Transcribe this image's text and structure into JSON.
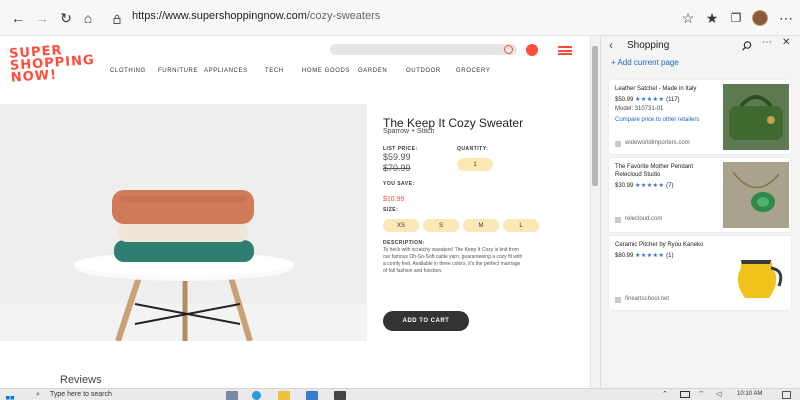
{
  "browser": {
    "url_host": "https://www.supershoppingnow.com",
    "url_path": "/cozy-sweaters"
  },
  "site": {
    "logo_lines": [
      "SUPER",
      "SHOPPING",
      "NOW!"
    ],
    "nav": [
      "CLOTHING",
      "FURNITURE",
      "APPLIANCES",
      "TECH",
      "HOME GOODS",
      "GARDEN",
      "OUTDOOR",
      "GROCERY"
    ]
  },
  "product": {
    "title": "The Keep It Cozy Sweater",
    "brand": "Sparrow + Stitch",
    "list_price_label": "LIST PRICE:",
    "list_price": "$59.99",
    "old_price": "$70.99",
    "quantity_label": "QUANTITY:",
    "quantity": "1",
    "you_save_label": "YOU SAVE:",
    "you_save": "$10.99",
    "size_label": "SIZE:",
    "sizes": [
      "XS",
      "S",
      "M",
      "L"
    ],
    "description_label": "DESCRIPTION:",
    "description": "To heck with scratchy sweaters! The Keep It Cozy is knit from our famous Oh-So-Soft cable yarn, guaranteeing a cozy fit with a comfy feel. Available in three colors, it's the perfect marriage of fall fashion and function.",
    "add_to_cart": "ADD TO CART",
    "reviews": "Reviews"
  },
  "shopping_panel": {
    "title": "Shopping",
    "add_current_page": "Add current page",
    "items": [
      {
        "name": "Leather Satchel - Made in Italy",
        "price": "$50.99",
        "stars": "★★★★★",
        "count": "(117)",
        "model": "Model: 310731-01",
        "link": "Compare price to other retailers",
        "shop": "wideworldimporters.com"
      },
      {
        "name": "The Favorite Mother Pendant",
        "name2": "Relecloud Studio",
        "price": "$30.99",
        "stars": "★★★★★",
        "count": "(7)",
        "shop": "relecloud.com"
      },
      {
        "name": "Ceramic Pitcher by Ryou Kaneko",
        "price": "$80.99",
        "stars": "★★★★★",
        "count": "(1)",
        "shop": "fineartschool.net"
      }
    ]
  },
  "taskbar": {
    "search": "Type here to search",
    "time": "10:10 AM"
  },
  "colors": {
    "brand": "#ff4d3a",
    "accent": "#1a66c2",
    "pill": "#fbe8b4",
    "button": "#333333"
  }
}
